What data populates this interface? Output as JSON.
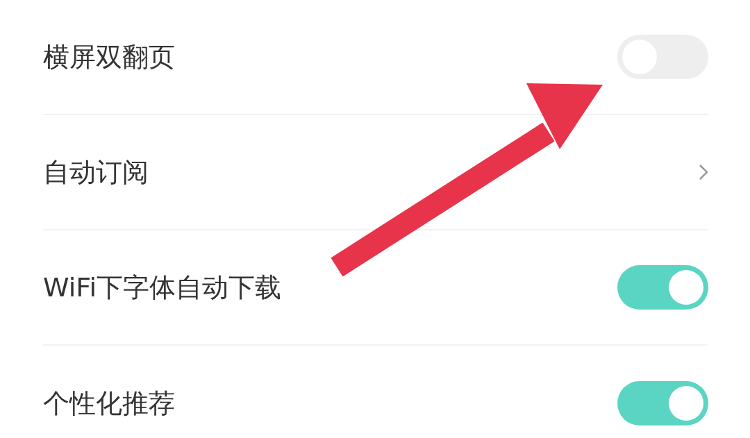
{
  "settings": [
    {
      "kind": "toggle",
      "label": "横屏双翻页",
      "on": false
    },
    {
      "kind": "link",
      "label": "自动订阅"
    },
    {
      "kind": "toggle",
      "label": "WiFi下字体自动下载",
      "on": true
    },
    {
      "kind": "toggle",
      "label": "个性化推荐",
      "on": true
    }
  ]
}
